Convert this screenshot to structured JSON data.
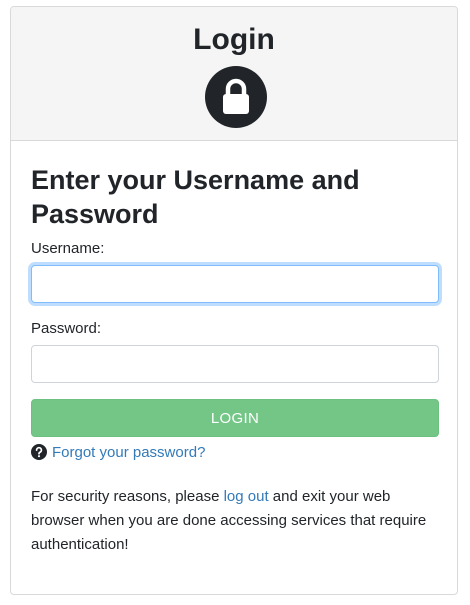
{
  "header": {
    "title": "Login",
    "icon": "lock-icon"
  },
  "form": {
    "heading": "Enter your Username and Password",
    "username_label": "Username:",
    "username_value": "",
    "password_label": "Password:",
    "password_value": "",
    "login_button": "LOGIN",
    "forgot_icon": "question-circle-icon",
    "forgot_link": "Forgot your password?"
  },
  "security_note": {
    "before": "For security reasons, please ",
    "link": "log out",
    "after": " and exit your web browser when you are done accessing services that require authentication!"
  },
  "colors": {
    "login_button": "#74c687",
    "link": "#337ab7",
    "focus_border": "#80bdff",
    "header_bg": "#f5f5f5"
  }
}
